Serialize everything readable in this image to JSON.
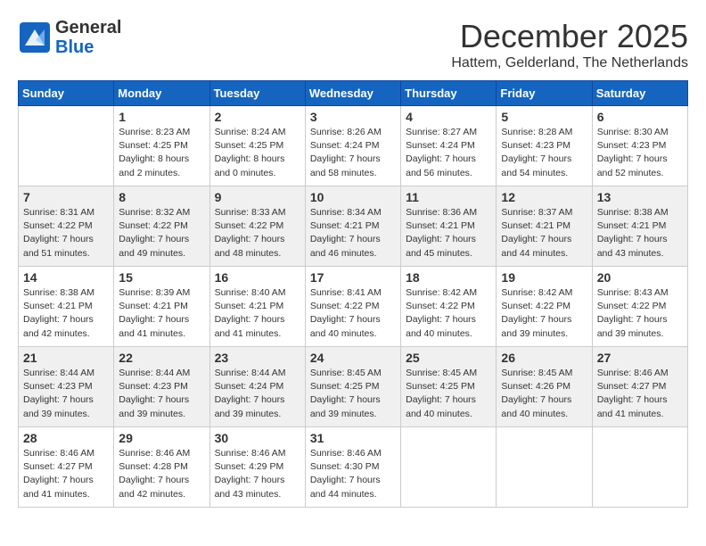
{
  "header": {
    "logo_general": "General",
    "logo_blue": "Blue",
    "month_title": "December 2025",
    "subtitle": "Hattem, Gelderland, The Netherlands"
  },
  "weekdays": [
    "Sunday",
    "Monday",
    "Tuesday",
    "Wednesday",
    "Thursday",
    "Friday",
    "Saturday"
  ],
  "weeks": [
    [
      {
        "day": "",
        "info": ""
      },
      {
        "day": "1",
        "info": "Sunrise: 8:23 AM\nSunset: 4:25 PM\nDaylight: 8 hours\nand 2 minutes."
      },
      {
        "day": "2",
        "info": "Sunrise: 8:24 AM\nSunset: 4:25 PM\nDaylight: 8 hours\nand 0 minutes."
      },
      {
        "day": "3",
        "info": "Sunrise: 8:26 AM\nSunset: 4:24 PM\nDaylight: 7 hours\nand 58 minutes."
      },
      {
        "day": "4",
        "info": "Sunrise: 8:27 AM\nSunset: 4:24 PM\nDaylight: 7 hours\nand 56 minutes."
      },
      {
        "day": "5",
        "info": "Sunrise: 8:28 AM\nSunset: 4:23 PM\nDaylight: 7 hours\nand 54 minutes."
      },
      {
        "day": "6",
        "info": "Sunrise: 8:30 AM\nSunset: 4:23 PM\nDaylight: 7 hours\nand 52 minutes."
      }
    ],
    [
      {
        "day": "7",
        "info": "Sunrise: 8:31 AM\nSunset: 4:22 PM\nDaylight: 7 hours\nand 51 minutes."
      },
      {
        "day": "8",
        "info": "Sunrise: 8:32 AM\nSunset: 4:22 PM\nDaylight: 7 hours\nand 49 minutes."
      },
      {
        "day": "9",
        "info": "Sunrise: 8:33 AM\nSunset: 4:22 PM\nDaylight: 7 hours\nand 48 minutes."
      },
      {
        "day": "10",
        "info": "Sunrise: 8:34 AM\nSunset: 4:21 PM\nDaylight: 7 hours\nand 46 minutes."
      },
      {
        "day": "11",
        "info": "Sunrise: 8:36 AM\nSunset: 4:21 PM\nDaylight: 7 hours\nand 45 minutes."
      },
      {
        "day": "12",
        "info": "Sunrise: 8:37 AM\nSunset: 4:21 PM\nDaylight: 7 hours\nand 44 minutes."
      },
      {
        "day": "13",
        "info": "Sunrise: 8:38 AM\nSunset: 4:21 PM\nDaylight: 7 hours\nand 43 minutes."
      }
    ],
    [
      {
        "day": "14",
        "info": "Sunrise: 8:38 AM\nSunset: 4:21 PM\nDaylight: 7 hours\nand 42 minutes."
      },
      {
        "day": "15",
        "info": "Sunrise: 8:39 AM\nSunset: 4:21 PM\nDaylight: 7 hours\nand 41 minutes."
      },
      {
        "day": "16",
        "info": "Sunrise: 8:40 AM\nSunset: 4:21 PM\nDaylight: 7 hours\nand 41 minutes."
      },
      {
        "day": "17",
        "info": "Sunrise: 8:41 AM\nSunset: 4:22 PM\nDaylight: 7 hours\nand 40 minutes."
      },
      {
        "day": "18",
        "info": "Sunrise: 8:42 AM\nSunset: 4:22 PM\nDaylight: 7 hours\nand 40 minutes."
      },
      {
        "day": "19",
        "info": "Sunrise: 8:42 AM\nSunset: 4:22 PM\nDaylight: 7 hours\nand 39 minutes."
      },
      {
        "day": "20",
        "info": "Sunrise: 8:43 AM\nSunset: 4:22 PM\nDaylight: 7 hours\nand 39 minutes."
      }
    ],
    [
      {
        "day": "21",
        "info": "Sunrise: 8:44 AM\nSunset: 4:23 PM\nDaylight: 7 hours\nand 39 minutes."
      },
      {
        "day": "22",
        "info": "Sunrise: 8:44 AM\nSunset: 4:23 PM\nDaylight: 7 hours\nand 39 minutes."
      },
      {
        "day": "23",
        "info": "Sunrise: 8:44 AM\nSunset: 4:24 PM\nDaylight: 7 hours\nand 39 minutes."
      },
      {
        "day": "24",
        "info": "Sunrise: 8:45 AM\nSunset: 4:25 PM\nDaylight: 7 hours\nand 39 minutes."
      },
      {
        "day": "25",
        "info": "Sunrise: 8:45 AM\nSunset: 4:25 PM\nDaylight: 7 hours\nand 40 minutes."
      },
      {
        "day": "26",
        "info": "Sunrise: 8:45 AM\nSunset: 4:26 PM\nDaylight: 7 hours\nand 40 minutes."
      },
      {
        "day": "27",
        "info": "Sunrise: 8:46 AM\nSunset: 4:27 PM\nDaylight: 7 hours\nand 41 minutes."
      }
    ],
    [
      {
        "day": "28",
        "info": "Sunrise: 8:46 AM\nSunset: 4:27 PM\nDaylight: 7 hours\nand 41 minutes."
      },
      {
        "day": "29",
        "info": "Sunrise: 8:46 AM\nSunset: 4:28 PM\nDaylight: 7 hours\nand 42 minutes."
      },
      {
        "day": "30",
        "info": "Sunrise: 8:46 AM\nSunset: 4:29 PM\nDaylight: 7 hours\nand 43 minutes."
      },
      {
        "day": "31",
        "info": "Sunrise: 8:46 AM\nSunset: 4:30 PM\nDaylight: 7 hours\nand 44 minutes."
      },
      {
        "day": "",
        "info": ""
      },
      {
        "day": "",
        "info": ""
      },
      {
        "day": "",
        "info": ""
      }
    ]
  ]
}
